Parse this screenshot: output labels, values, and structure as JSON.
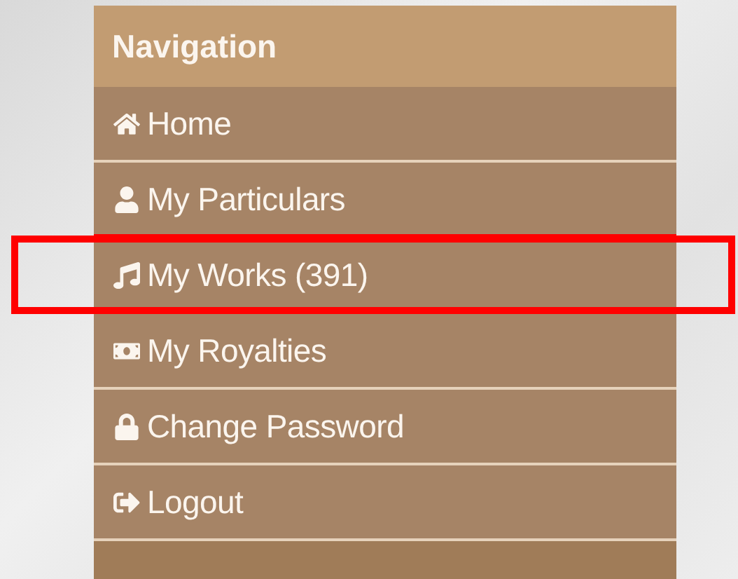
{
  "panel": {
    "title": "Navigation"
  },
  "items": [
    {
      "label": "Home",
      "highlighted": false
    },
    {
      "label": "My Particulars",
      "highlighted": false
    },
    {
      "label": "My Works (391)",
      "highlighted": true
    },
    {
      "label": "My Royalties",
      "highlighted": false
    },
    {
      "label": "Change Password",
      "highlighted": false
    },
    {
      "label": "Logout",
      "highlighted": false
    }
  ]
}
